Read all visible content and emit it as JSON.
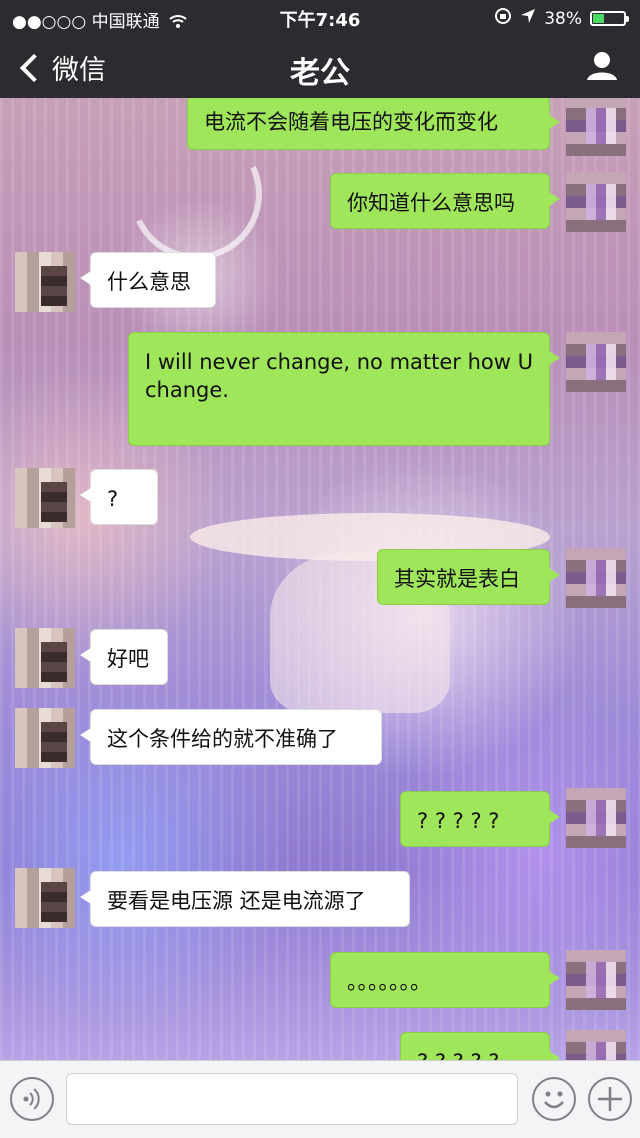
{
  "status_bar": {
    "carrier": "●●○○○ 中国联通",
    "time": "下午7:46",
    "battery_percent": "38%",
    "battery_level": 0.38
  },
  "nav": {
    "back_label": "微信",
    "title": "老公"
  },
  "messages": [
    {
      "from": "me",
      "text": "电流不会随着电压的变化而变化"
    },
    {
      "from": "me",
      "text": "你知道什么意思吗"
    },
    {
      "from": "them",
      "text": "什么意思"
    },
    {
      "from": "me",
      "text": "I will never change, no matter how U change."
    },
    {
      "from": "them",
      "text": "?"
    },
    {
      "from": "me",
      "text": "其实就是表白"
    },
    {
      "from": "them",
      "text": "好吧"
    },
    {
      "from": "them",
      "text": "这个条件给的就不准确了"
    },
    {
      "from": "me",
      "text": "? ? ? ? ?"
    },
    {
      "from": "them",
      "text": "要看是电压源 还是电流源了"
    },
    {
      "from": "me",
      "text": "。。。。。。。"
    },
    {
      "from": "me",
      "text": "? ? ? ? ?"
    }
  ],
  "input": {
    "value": ""
  },
  "colors": {
    "my_bubble": "#9fe65a",
    "their_bubble": "#ffffff",
    "top_bar": "#2b2b30",
    "battery": "#4cd964"
  }
}
